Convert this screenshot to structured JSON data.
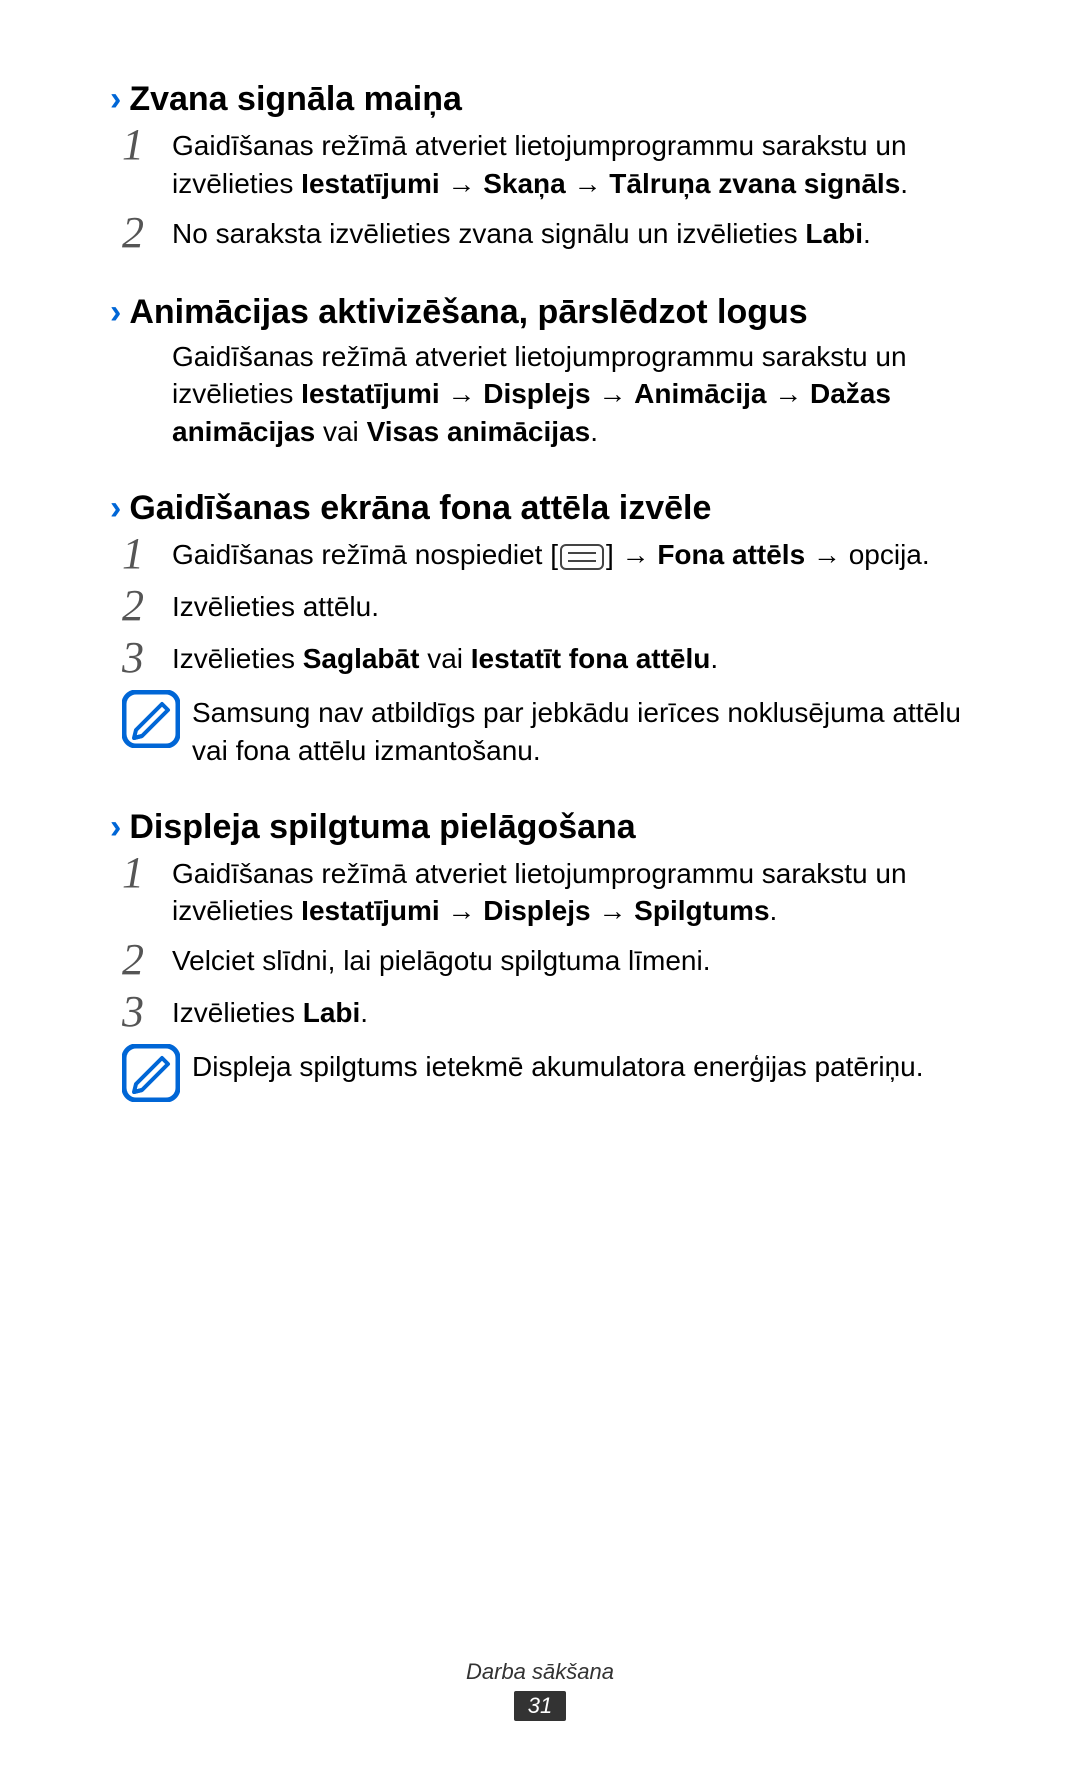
{
  "sections": [
    {
      "title": "Zvana signāla maiņa",
      "items": [
        {
          "type": "ol",
          "num": "1",
          "segments": [
            {
              "t": "Gaidīšanas režīmā atveriet lietojumprogrammu sarakstu un izvēlieties "
            },
            {
              "t": "Iestatījumi",
              "b": true
            },
            {
              "t": " → "
            },
            {
              "t": "Skaņa",
              "b": true
            },
            {
              "t": " → "
            },
            {
              "t": "Tālruņa zvana signāls",
              "b": true
            },
            {
              "t": "."
            }
          ]
        },
        {
          "type": "ol",
          "num": "2",
          "segments": [
            {
              "t": "No saraksta izvēlieties zvana signālu un izvēlieties "
            },
            {
              "t": "Labi",
              "b": true
            },
            {
              "t": "."
            }
          ]
        }
      ]
    },
    {
      "title": "Animācijas aktivizēšana, pārslēdzot logus",
      "items": [
        {
          "type": "body",
          "segments": [
            {
              "t": "Gaidīšanas režīmā atveriet lietojumprogrammu sarakstu un izvēlieties "
            },
            {
              "t": "Iestatījumi",
              "b": true
            },
            {
              "t": " → "
            },
            {
              "t": "Displejs",
              "b": true
            },
            {
              "t": " → "
            },
            {
              "t": "Animācija",
              "b": true
            },
            {
              "t": " → "
            },
            {
              "t": "Dažas animācijas",
              "b": true
            },
            {
              "t": " vai "
            },
            {
              "t": "Visas animācijas",
              "b": true
            },
            {
              "t": "."
            }
          ]
        }
      ]
    },
    {
      "title": "Gaidīšanas ekrāna fona attēla izvēle",
      "items": [
        {
          "type": "ol",
          "num": "1",
          "segments": [
            {
              "t": "Gaidīšanas režīmā nospiediet ["
            },
            {
              "icon": "menu"
            },
            {
              "t": "] → "
            },
            {
              "t": "Fona attēls",
              "b": true
            },
            {
              "t": " → opcija."
            }
          ]
        },
        {
          "type": "ol",
          "num": "2",
          "segments": [
            {
              "t": "Izvēlieties attēlu."
            }
          ]
        },
        {
          "type": "ol",
          "num": "3",
          "segments": [
            {
              "t": "Izvēlieties "
            },
            {
              "t": "Saglabāt",
              "b": true
            },
            {
              "t": " vai "
            },
            {
              "t": "Iestatīt fona attēlu",
              "b": true
            },
            {
              "t": "."
            }
          ]
        },
        {
          "type": "note",
          "segments": [
            {
              "t": "Samsung nav atbildīgs par jebkādu ierīces noklusējuma attēlu vai fona attēlu izmantošanu."
            }
          ]
        }
      ]
    },
    {
      "title": "Displeja spilgtuma pielāgošana",
      "items": [
        {
          "type": "ol",
          "num": "1",
          "segments": [
            {
              "t": "Gaidīšanas režīmā atveriet lietojumprogrammu sarakstu un izvēlieties "
            },
            {
              "t": "Iestatījumi",
              "b": true
            },
            {
              "t": " → "
            },
            {
              "t": "Displejs",
              "b": true
            },
            {
              "t": " → "
            },
            {
              "t": "Spilgtums",
              "b": true
            },
            {
              "t": "."
            }
          ]
        },
        {
          "type": "ol",
          "num": "2",
          "segments": [
            {
              "t": "Velciet slīdni, lai pielāgotu spilgtuma līmeni."
            }
          ]
        },
        {
          "type": "ol",
          "num": "3",
          "segments": [
            {
              "t": "Izvēlieties "
            },
            {
              "t": "Labi",
              "b": true
            },
            {
              "t": "."
            }
          ]
        },
        {
          "type": "note",
          "segments": [
            {
              "t": "Displeja spilgtums ietekmē akumulatora enerģijas patēriņu."
            }
          ]
        }
      ]
    }
  ],
  "footer": {
    "label": "Darba sākšana",
    "page": "31"
  }
}
